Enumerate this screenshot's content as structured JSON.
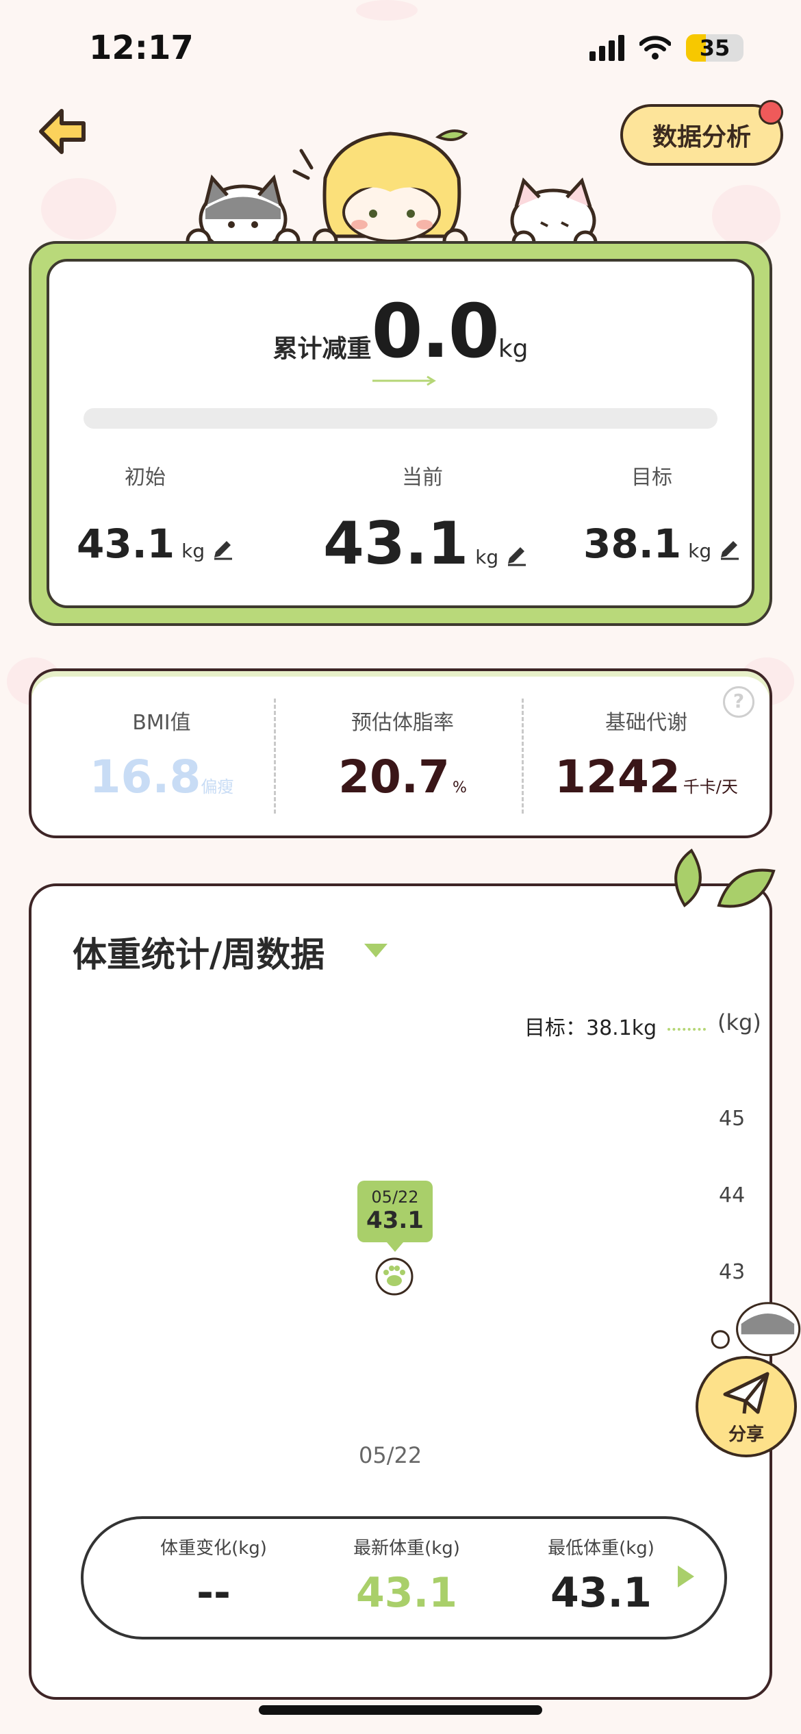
{
  "status": {
    "time": "12:17",
    "battery": "35"
  },
  "header": {
    "analysis_label": "数据分析"
  },
  "summary_card": {
    "total_loss_label": "累计减重",
    "total_loss_value": "0.0",
    "unit": "kg",
    "columns": [
      {
        "label": "初始",
        "value": "43.1",
        "unit": "kg"
      },
      {
        "label": "当前",
        "value": "43.1",
        "unit": "kg"
      },
      {
        "label": "目标",
        "value": "38.1",
        "unit": "kg"
      }
    ]
  },
  "metrics": [
    {
      "label": "BMI值",
      "value": "16.8",
      "unit": "偏瘦"
    },
    {
      "label": "预估体脂率",
      "value": "20.7",
      "unit": "%"
    },
    {
      "label": "基础代谢",
      "value": "1242",
      "unit": "千卡/天"
    }
  ],
  "weight_chart": {
    "title": "体重统计/周数据",
    "target_legend": "目标：38.1kg",
    "unit_label": "(kg)",
    "y_ticks": [
      "45",
      "44",
      "43"
    ],
    "tooltip_date": "05/22",
    "tooltip_value": "43.1",
    "x_label": "05/22"
  },
  "chart_data": {
    "type": "line",
    "x": [
      "05/22"
    ],
    "series": [
      {
        "values": [
          43.1
        ]
      }
    ],
    "yticks": [
      45,
      44,
      43
    ]
  },
  "weight_summary": [
    {
      "label": "体重变化(kg)",
      "value": "--"
    },
    {
      "label": "最新体重(kg)",
      "value": "43.1"
    },
    {
      "label": "最低体重(kg)",
      "value": "43.1"
    }
  ],
  "share": {
    "label": "分享"
  },
  "colors": {
    "accent_green": "#a9cf6a",
    "bmi_blue": "#c8dcf5",
    "dark_red": "#3a1618",
    "button_yellow": "#fde49a"
  }
}
